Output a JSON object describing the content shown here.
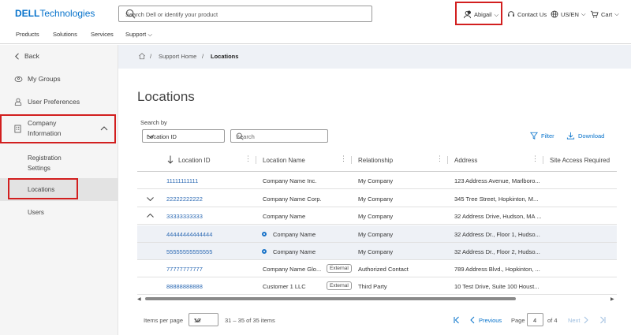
{
  "header": {
    "logo_brand": "DELL",
    "logo_suffix": "Technologies",
    "search_placeholder": "Search Dell or identify your product",
    "user_name": "Abigail",
    "contact": "Contact Us",
    "locale": "US/EN",
    "cart": "Cart"
  },
  "nav": {
    "items": [
      "Products",
      "Solutions",
      "Services",
      "Support"
    ]
  },
  "sidebar": {
    "back": "Back",
    "groups": "My Groups",
    "prefs": "User Preferences",
    "company_line1": "Company",
    "company_line2": "Information",
    "reg_line1": "Registration",
    "reg_line2": "Settings",
    "locations": "Locations",
    "users": "Users"
  },
  "breadcrumb": {
    "sep": "/",
    "support_home": "Support Home",
    "current": "Locations"
  },
  "page": {
    "title": "Locations",
    "search_by": "Search by",
    "search_field": "Location ID",
    "search_placeholder": "Search",
    "filter": "Filter",
    "download": "Download"
  },
  "table": {
    "headers": [
      "Location ID",
      "Location Name",
      "Relationship",
      "Address",
      "Site Access Required"
    ],
    "rows": [
      {
        "id": "11111111111",
        "name": "Company Name Inc.",
        "badge": "",
        "rel": "My Company",
        "addr": "123 Address Avenue, Marlboro..."
      },
      {
        "id": "22222222222",
        "name": "Company Name Corp.",
        "badge": "",
        "rel": "My Company",
        "addr": "345 Tree Street, Hopkinton, M..."
      },
      {
        "id": "33333333333",
        "name": "Company Name",
        "badge": "",
        "rel": "My Company",
        "addr": "32 Address Drive, Hudson, MA ..."
      },
      {
        "id": "44444444444444",
        "name": "Company Name",
        "badge": "",
        "rel": "My Company",
        "addr": "32 Address Dr., Floor 1, Hudso..."
      },
      {
        "id": "55555555555555",
        "name": "Company Name",
        "badge": "",
        "rel": "My Company",
        "addr": "32 Address Dr., Floor 2, Hudso..."
      },
      {
        "id": "77777777777",
        "name": "Company Name Glo...",
        "badge": "External",
        "rel": "Authorized Contact",
        "addr": "789 Address Blvd., Hopkinton, ..."
      },
      {
        "id": "88888888888",
        "name": "Customer 1 LLC",
        "badge": "External",
        "rel": "Third Party",
        "addr": "10 Test Drive, Suite 100 Houst..."
      }
    ]
  },
  "pagination": {
    "items_per_page_label": "Items per page",
    "items_per_page": "10",
    "range": "31 – 35 of 35 items",
    "previous": "Previous",
    "page_label": "Page",
    "page": "4",
    "of": "of 4",
    "next": "Next"
  },
  "colors": {
    "accent": "#0672cb",
    "highlight": "#d21f1f"
  }
}
